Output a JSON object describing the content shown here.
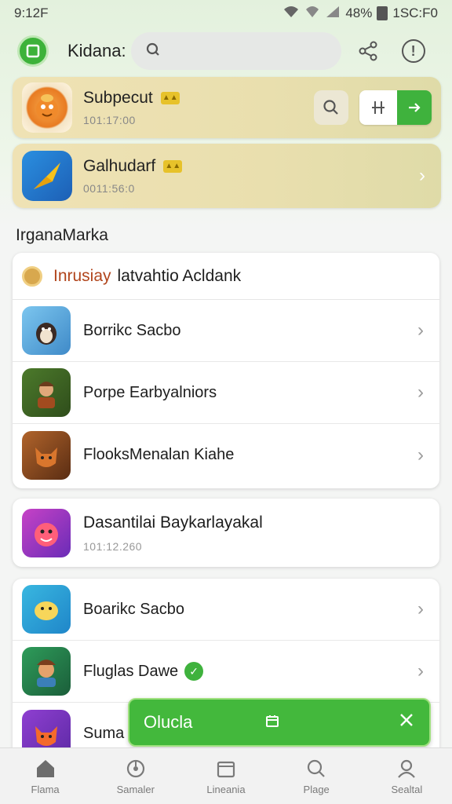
{
  "status_bar": {
    "time": "9:12F",
    "battery": "48%",
    "clock": "1SC:F0"
  },
  "header": {
    "title": "Kidana:",
    "search_placeholder": ""
  },
  "featured": [
    {
      "title": "Subpecut",
      "subtitle": "101:17:00"
    },
    {
      "title": "Galhudarf",
      "subtitle": "0011:56:0"
    }
  ],
  "section": {
    "title": "IrganaMarka",
    "card_header": {
      "highlight": "Inrusiay",
      "text": "latvahtio Acldank"
    },
    "rows": [
      {
        "label": "Borrikc Sacbo"
      },
      {
        "label": "Porpe Earbyalniors"
      },
      {
        "label": "FlooksMenalan Kiahe"
      }
    ]
  },
  "single": {
    "title": "Dasantilai Baykarlayakal",
    "subtitle": "101:12.260"
  },
  "list_c": {
    "rows": [
      {
        "label": "Boarikc Sacbo"
      },
      {
        "label": "Fluglas Dawe"
      },
      {
        "label": "Suma"
      }
    ]
  },
  "toast": {
    "label": "Olucla"
  },
  "nav": [
    {
      "label": "Flama",
      "icon": "home-icon"
    },
    {
      "label": "Samaler",
      "icon": "wheel-icon"
    },
    {
      "label": "Lineania",
      "icon": "calendar-icon"
    },
    {
      "label": "Plage",
      "icon": "search-icon"
    },
    {
      "label": "Sealtal",
      "icon": "profile-icon"
    }
  ],
  "colors": {
    "accent": "#3fb23d",
    "card_gold": "#ebe0af"
  }
}
